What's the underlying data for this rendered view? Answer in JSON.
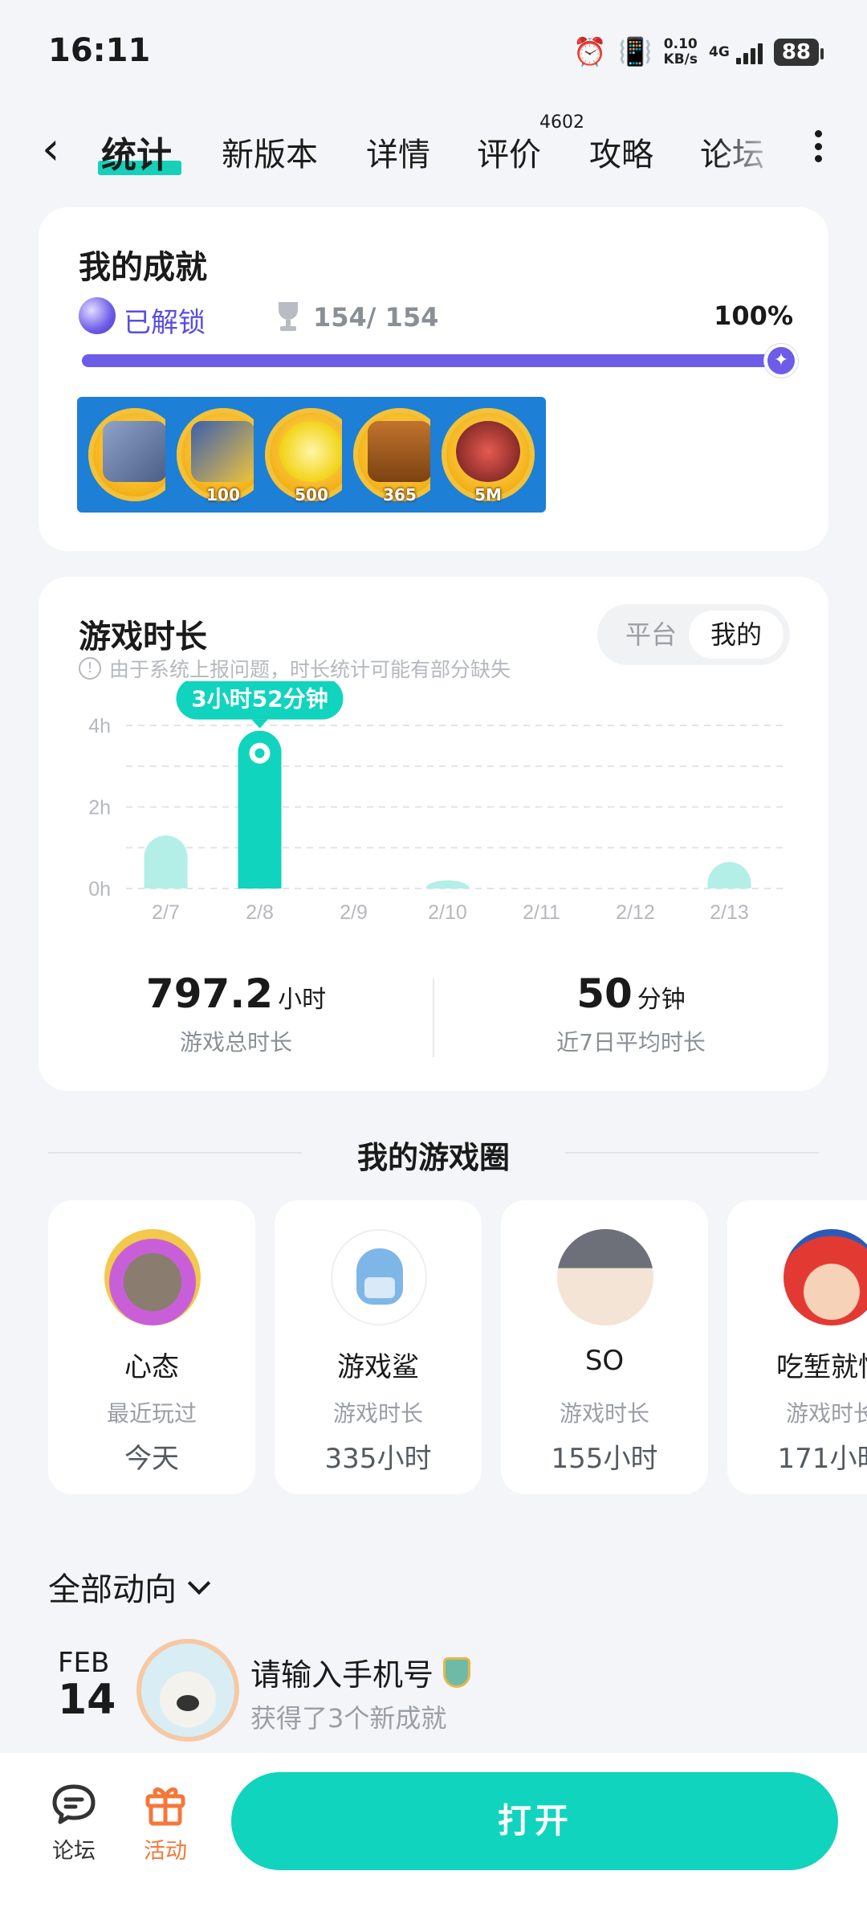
{
  "status_bar": {
    "time": "16:11",
    "net_speed_value": "0.10",
    "net_speed_unit": "KB/s",
    "network": "4G",
    "battery": "88"
  },
  "tabs": {
    "items": [
      "统计",
      "新版本",
      "详情",
      "评价",
      "攻略",
      "论坛"
    ],
    "active_index": 0,
    "review_count": "4602",
    "accent": "#18d0b8"
  },
  "achievements": {
    "title": "我的成就",
    "unlocked_label": "已解锁",
    "count": "154/ 154",
    "percent_text": "100%",
    "progress": 1.0,
    "accent": "#6c5ce7",
    "badges": [
      {
        "icon": "trophy-badge",
        "label": ""
      },
      {
        "icon": "album-badge",
        "label": "100"
      },
      {
        "icon": "coin-badge",
        "label": "500"
      },
      {
        "icon": "treasure-chest-badge",
        "label": "365"
      },
      {
        "icon": "bomb-badge",
        "label": "5M"
      }
    ]
  },
  "playtime": {
    "title": "游戏时长",
    "note": "由于系统上报问题，时长统计可能有部分缺失",
    "toggle": {
      "platform": "平台",
      "mine": "我的",
      "selected": "mine"
    },
    "highlight_label": "3小时52分钟",
    "total_value": "797.2",
    "total_unit": "小时",
    "total_label": "游戏总时长",
    "avg_value": "50",
    "avg_unit": "分钟",
    "avg_label": "近7日平均时长"
  },
  "chart_data": {
    "type": "bar",
    "categories": [
      "2/7",
      "2/8",
      "2/9",
      "2/10",
      "2/11",
      "2/12",
      "2/13"
    ],
    "values": [
      1.3,
      3.87,
      0,
      0.2,
      0,
      0,
      0.65
    ],
    "y_ticks": [
      "0h",
      "2h",
      "4h"
    ],
    "ylim": [
      0,
      4
    ],
    "highlight_index": 1,
    "grid": true,
    "colors": {
      "bar": "#b3efe6",
      "highlight": "#10d4bd"
    }
  },
  "game_circle": {
    "title": "我的游戏圈",
    "friends": [
      {
        "name": "心态",
        "label": "最近玩过",
        "value": "今天"
      },
      {
        "name": "游戏鲨",
        "label": "游戏时长",
        "value": "335小时"
      },
      {
        "name": "SO",
        "label": "游戏时长",
        "value": "155小时"
      },
      {
        "name": "吃堑就懂",
        "label": "游戏时长",
        "value": "171小时"
      }
    ]
  },
  "feed": {
    "filter": "全部动向",
    "items": [
      {
        "month": "FEB",
        "day": "14",
        "name": "请输入手机号",
        "text": "获得了3个新成就"
      }
    ]
  },
  "bottom_bar": {
    "forum": "论坛",
    "events": "活动",
    "open": "打开",
    "events_color": "#f5773a"
  }
}
